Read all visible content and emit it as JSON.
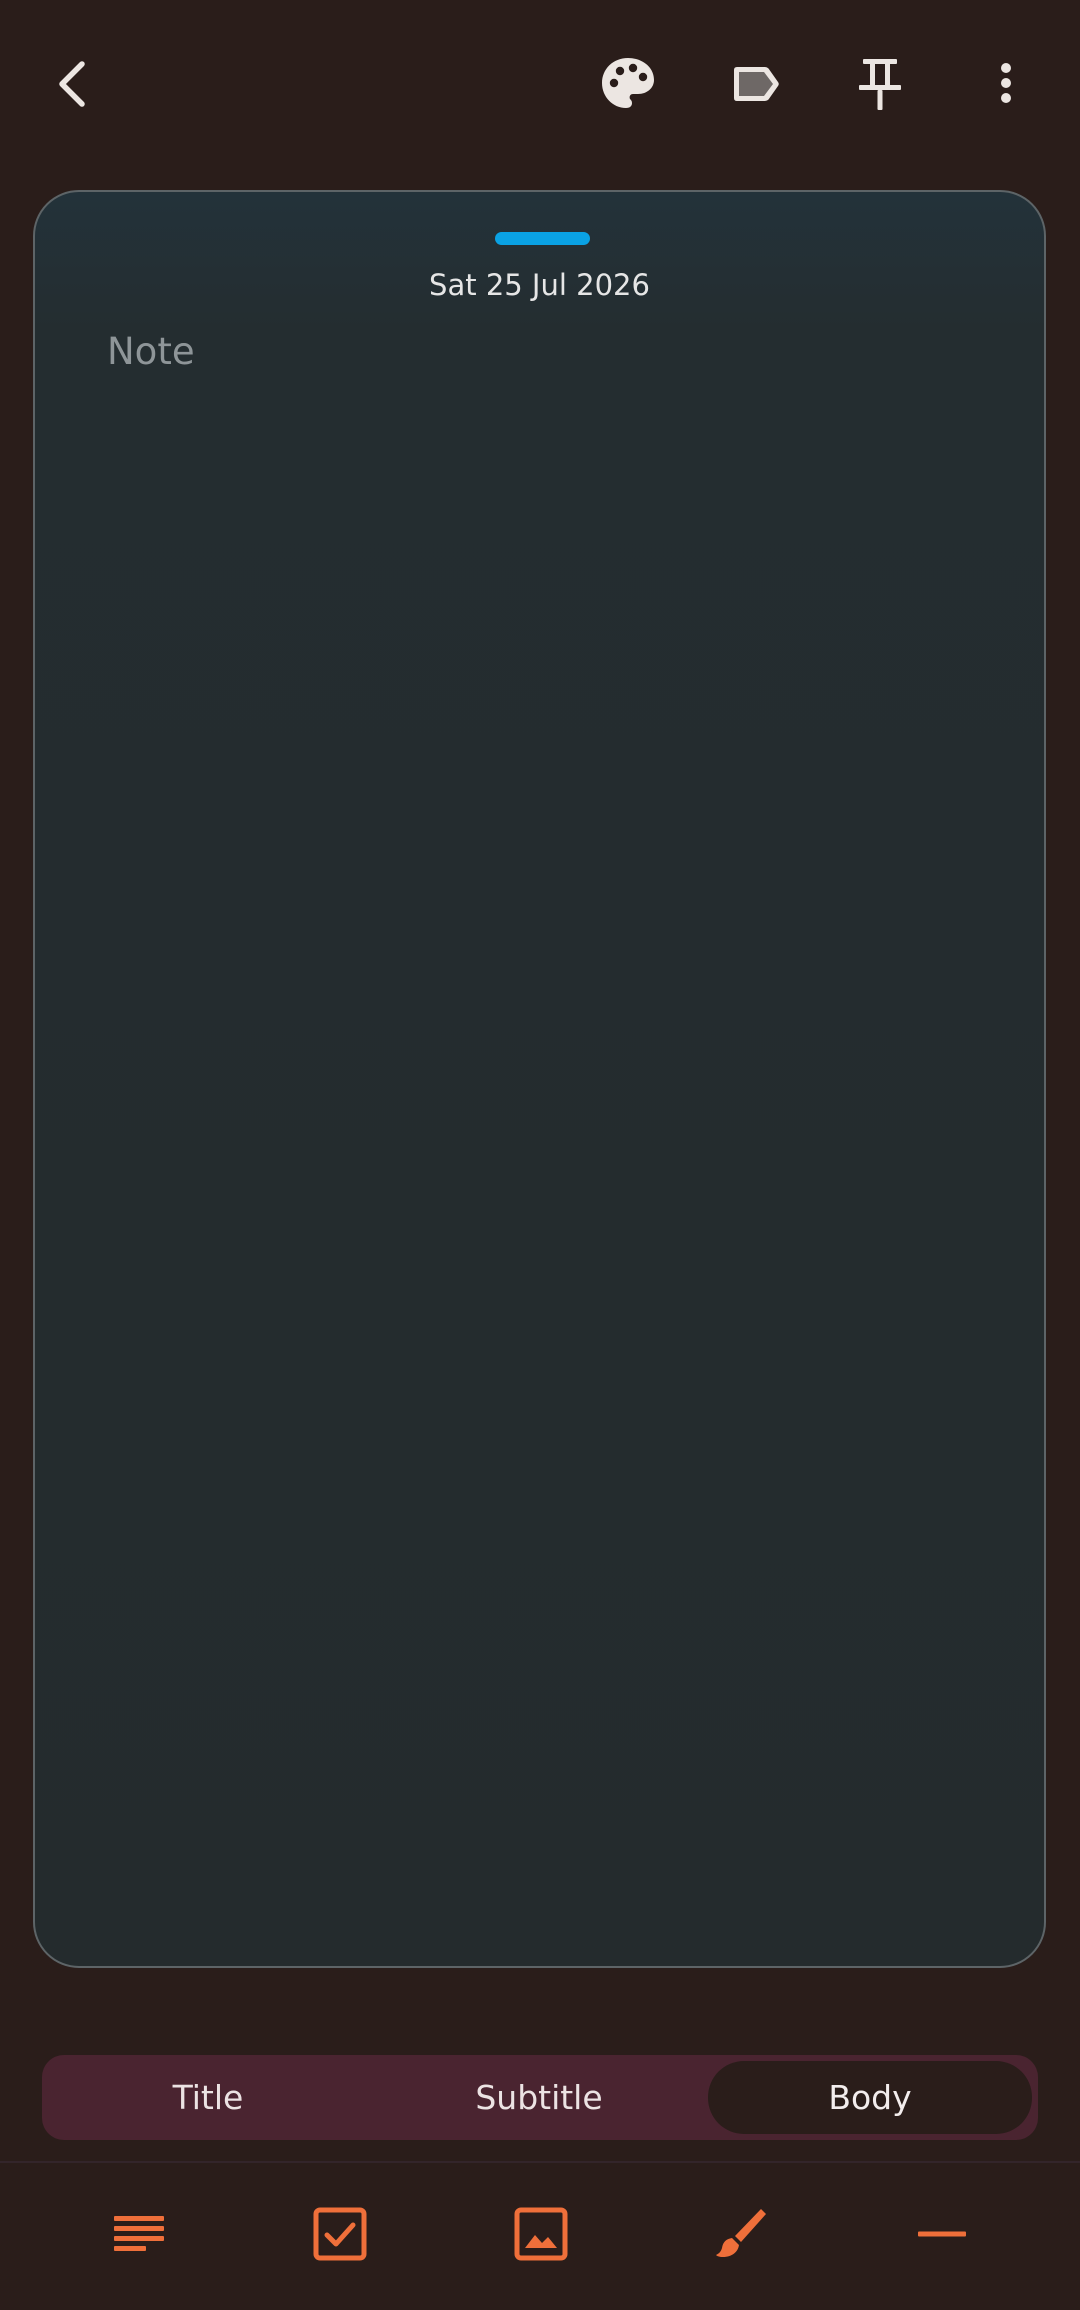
{
  "top_bar": {
    "icons": {
      "back": "arrow-back-icon",
      "palette": "palette-icon",
      "label": "label-icon",
      "pin": "pin-icon",
      "more": "more-vert-icon"
    },
    "icon_color": "#ece6e2"
  },
  "note": {
    "date": "Sat 25 Jul 2026",
    "placeholder": "Note",
    "accent_color": "#0aa2e4"
  },
  "text_style_selector": {
    "options": [
      "Title",
      "Subtitle",
      "Body"
    ],
    "selected": "Body"
  },
  "bottom_toolbar": {
    "icons": [
      "text-format-icon",
      "checklist-icon",
      "image-icon",
      "brush-icon",
      "divider-icon"
    ],
    "icon_color": "#ef6f3a"
  }
}
